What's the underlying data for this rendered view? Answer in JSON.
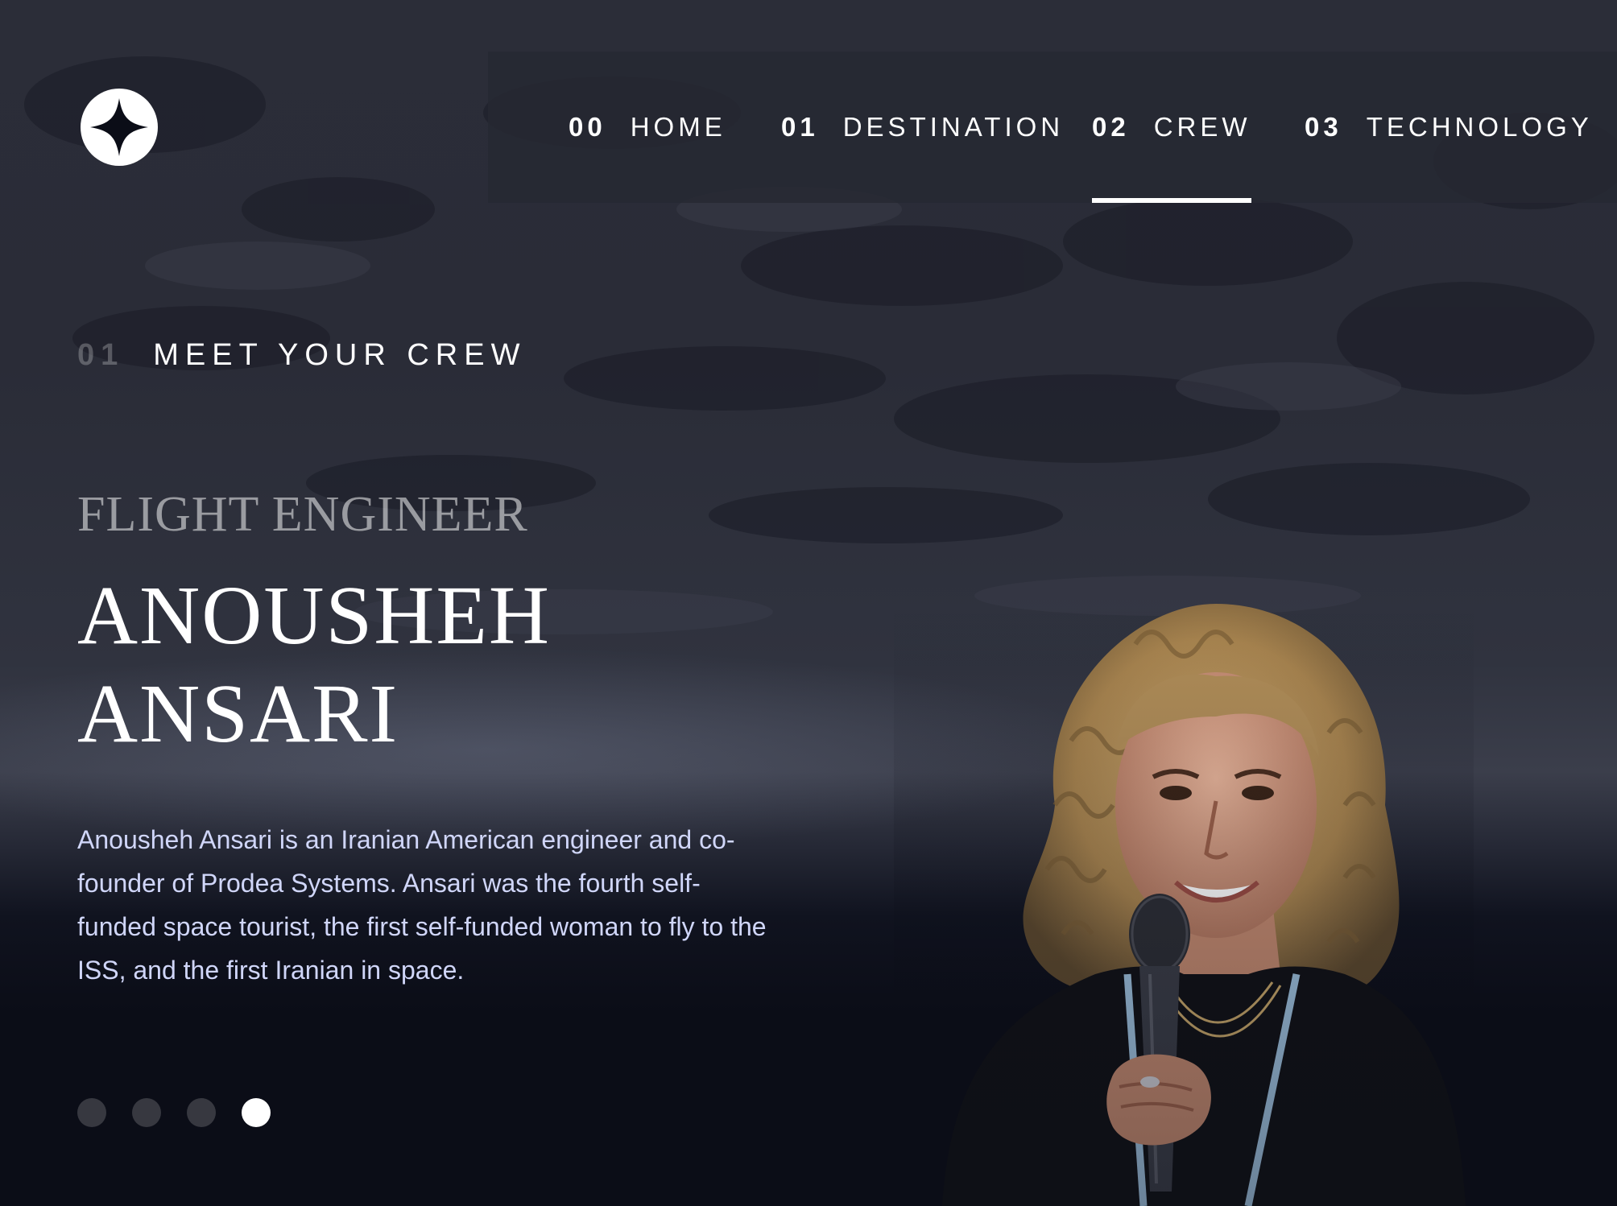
{
  "nav": {
    "items": [
      {
        "num": "00",
        "label": "HOME",
        "active": false
      },
      {
        "num": "01",
        "label": "DESTINATION",
        "active": false
      },
      {
        "num": "02",
        "label": "CREW",
        "active": true
      },
      {
        "num": "03",
        "label": "TECHNOLOGY",
        "active": false
      }
    ]
  },
  "heading": {
    "num": "01",
    "text": "MEET YOUR CREW"
  },
  "crew": {
    "role": "FLIGHT ENGINEER",
    "name_line1": "ANOUSHEH",
    "name_line2": "ANSARI",
    "bio_lines": [
      "Anousheh Ansari is an Iranian American engineer and co-",
      "founder of Prodea Systems. Ansari was the fourth self-",
      "funded space tourist, the first self-funded woman to fly to the",
      "ISS, and the first Iranian in space."
    ]
  },
  "carousel": {
    "total": 4,
    "active_index": 3
  },
  "colors": {
    "background": "#0b0d17",
    "text": "#ffffff",
    "body_text": "#d0d6f9",
    "nav_bg": "#262832"
  }
}
